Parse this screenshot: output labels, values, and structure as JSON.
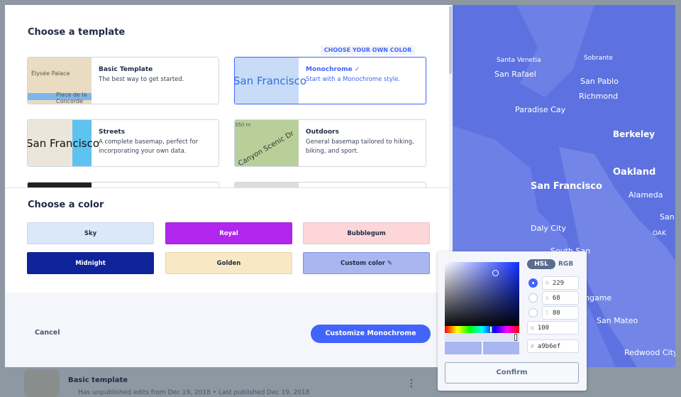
{
  "template_section": {
    "title": "Choose a template",
    "choose_own_color": "CHOOSE YOUR OWN COLOR",
    "templates": [
      {
        "name": "Basic Template",
        "desc": "The best way to get started.",
        "thumb_text": [
          "Élysée Palace",
          "Place de la Concorde"
        ]
      },
      {
        "name": "Monochrome ✓",
        "desc": "Start with a Monochrome style.",
        "thumb_text": [
          "San Francisco"
        ],
        "selected": true
      },
      {
        "name": "Streets",
        "desc": "A complete basemap, perfect for incorporating your own data.",
        "thumb_text": [
          "San Francisco"
        ]
      },
      {
        "name": "Outdoors",
        "desc": "General basemap tailored to hiking, biking, and sport.",
        "thumb_text": [
          "350 m",
          "Canyon Scenic Dr"
        ]
      }
    ]
  },
  "color_section": {
    "title": "Choose a color",
    "colors": [
      {
        "label": "Sky",
        "bg": "#dbe8fa",
        "fg": "#1f2a44"
      },
      {
        "label": "Royal",
        "bg": "#b026ec",
        "fg": "#ffffff"
      },
      {
        "label": "Bubblegum",
        "bg": "#fcd6d9",
        "fg": "#1f2a44"
      },
      {
        "label": "Midnight",
        "bg": "#0f239a",
        "fg": "#ffffff"
      },
      {
        "label": "Golden",
        "bg": "#f8e8c4",
        "fg": "#1f2a44"
      },
      {
        "label": "Custom color ✎",
        "bg": "#a9b6ef",
        "fg": "#1f2a44",
        "selected": true
      }
    ]
  },
  "footer": {
    "cancel": "Cancel",
    "customize": "Customize Monochrome"
  },
  "map_labels": [
    "Santa Venetia",
    "Sobrante",
    "San Rafael",
    "San Pablo",
    "Richmond",
    "Paradise Cay",
    "Berkeley",
    "Oakland",
    "San Francisco",
    "Alameda",
    "San",
    "Daly City",
    "OAK",
    "South San",
    "ngame",
    "San Mateo",
    "Redwood City"
  ],
  "picker": {
    "modes": [
      "HSL",
      "RGB"
    ],
    "active_mode": "HSL",
    "h": "229",
    "s": "68",
    "l": "80",
    "alpha": "100",
    "hex": "a9b6ef",
    "keys": {
      "h": "h",
      "s": "s",
      "l": "l",
      "a": "α",
      "hex": "#"
    },
    "confirm": "Confirm",
    "color": "#a9b6ef"
  },
  "background": {
    "item_title": "Basic template",
    "item_status": "Has unpublished edits from Dec 19, 2018 • Last published Dec 19, 2018"
  }
}
